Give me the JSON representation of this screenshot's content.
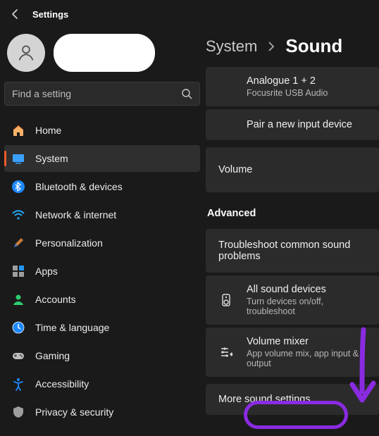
{
  "app": {
    "title": "Settings"
  },
  "search": {
    "placeholder": "Find a setting"
  },
  "sidebar": {
    "items": [
      {
        "label": "Home"
      },
      {
        "label": "System"
      },
      {
        "label": "Bluetooth & devices"
      },
      {
        "label": "Network & internet"
      },
      {
        "label": "Personalization"
      },
      {
        "label": "Apps"
      },
      {
        "label": "Accounts"
      },
      {
        "label": "Time & language"
      },
      {
        "label": "Gaming"
      },
      {
        "label": "Accessibility"
      },
      {
        "label": "Privacy & security"
      }
    ]
  },
  "breadcrumb": {
    "parent": "System",
    "current": "Sound"
  },
  "main": {
    "input_device": {
      "title": "Analogue 1 + 2",
      "sub": "Focusrite USB Audio"
    },
    "pair": {
      "title": "Pair a new input device"
    },
    "volume": {
      "title": "Volume"
    },
    "advanced_header": "Advanced",
    "troubleshoot": {
      "title": "Troubleshoot common sound problems"
    },
    "all_devices": {
      "title": "All sound devices",
      "sub": "Turn devices on/off, troubleshoot"
    },
    "mixer": {
      "title": "Volume mixer",
      "sub": "App volume mix, app input & output"
    },
    "more": {
      "title": "More sound settings"
    }
  },
  "annotation": {
    "color": "#8a2be2"
  }
}
